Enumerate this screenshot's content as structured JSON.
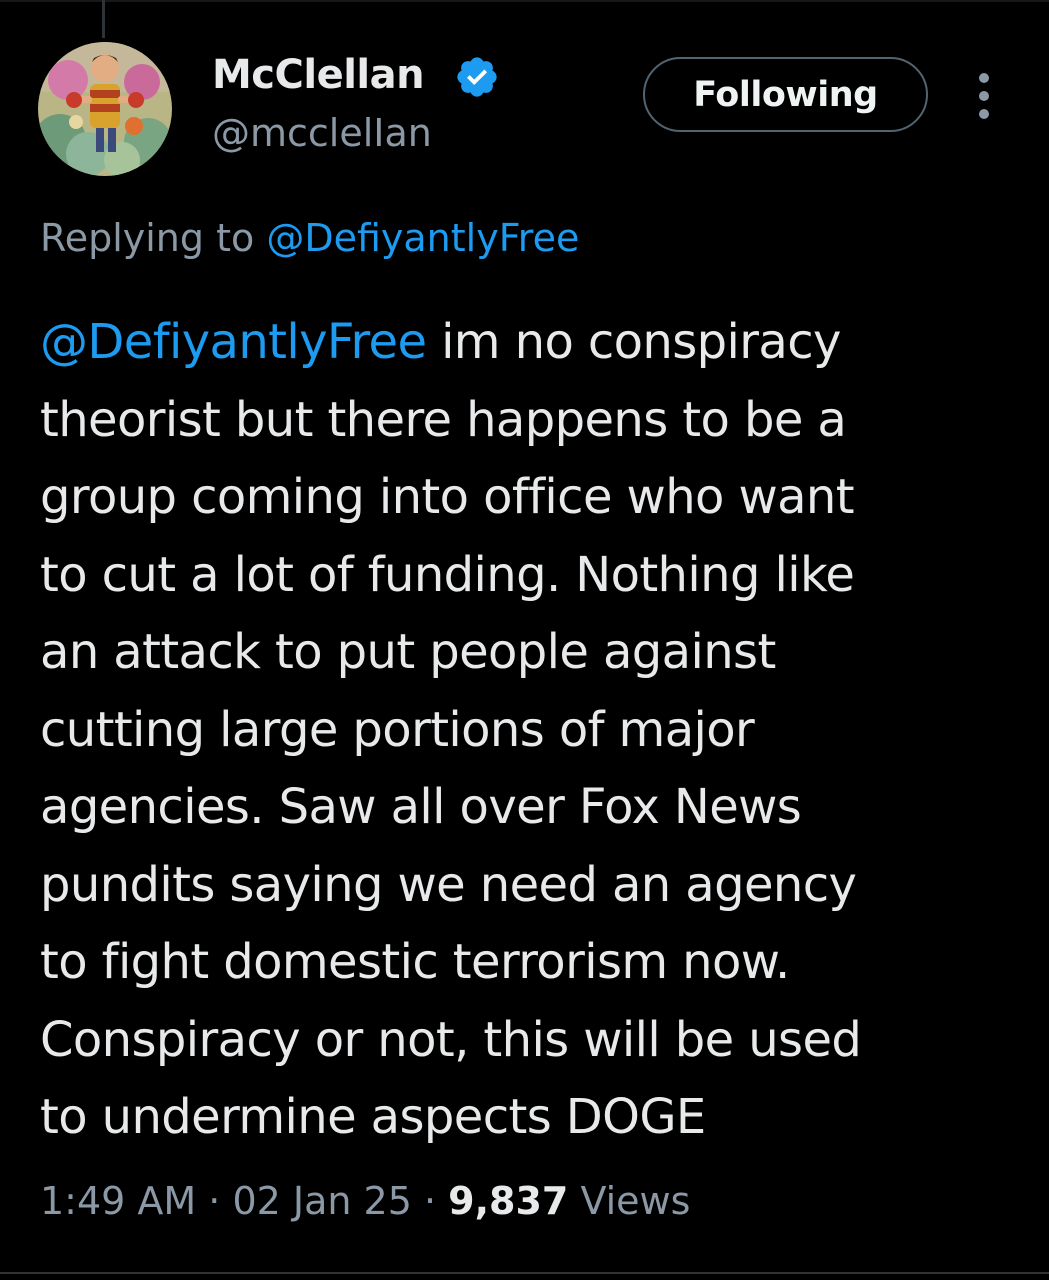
{
  "author": {
    "display_name": "McClellan",
    "handle": "@mcclelIan",
    "verified": true,
    "verified_icon": "verified-badge-icon",
    "verified_color": "#1d9bf0"
  },
  "follow_button": {
    "label": "Following"
  },
  "more_button": {
    "icon": "more-vertical-icon"
  },
  "reply": {
    "prefix": "Replying to",
    "mention": "@DefiyantlyFree"
  },
  "tweet": {
    "mention": "@DefiyantlyFree",
    "lines": [
      " im no conspiracy",
      "theorist but there happens to be a",
      "group coming into office who want",
      "to cut a lot of funding. Nothing like",
      "an attack to put people against",
      "cutting large portions of major",
      "agencies. Saw all over Fox News",
      "pundits saying we need an agency",
      "to fight domestic terrorism now.",
      "Conspiracy or not, this will be used",
      "to undermine aspects DOGE"
    ]
  },
  "meta": {
    "time": "1:49 AM",
    "separator": " · ",
    "date": "02 Jan 25",
    "views_count": "9,837",
    "views_label": " Views"
  },
  "colors": {
    "background": "#000000",
    "text_primary": "#e7e9ea",
    "text_secondary": "#8b98a5",
    "accent": "#1d9bf0"
  }
}
